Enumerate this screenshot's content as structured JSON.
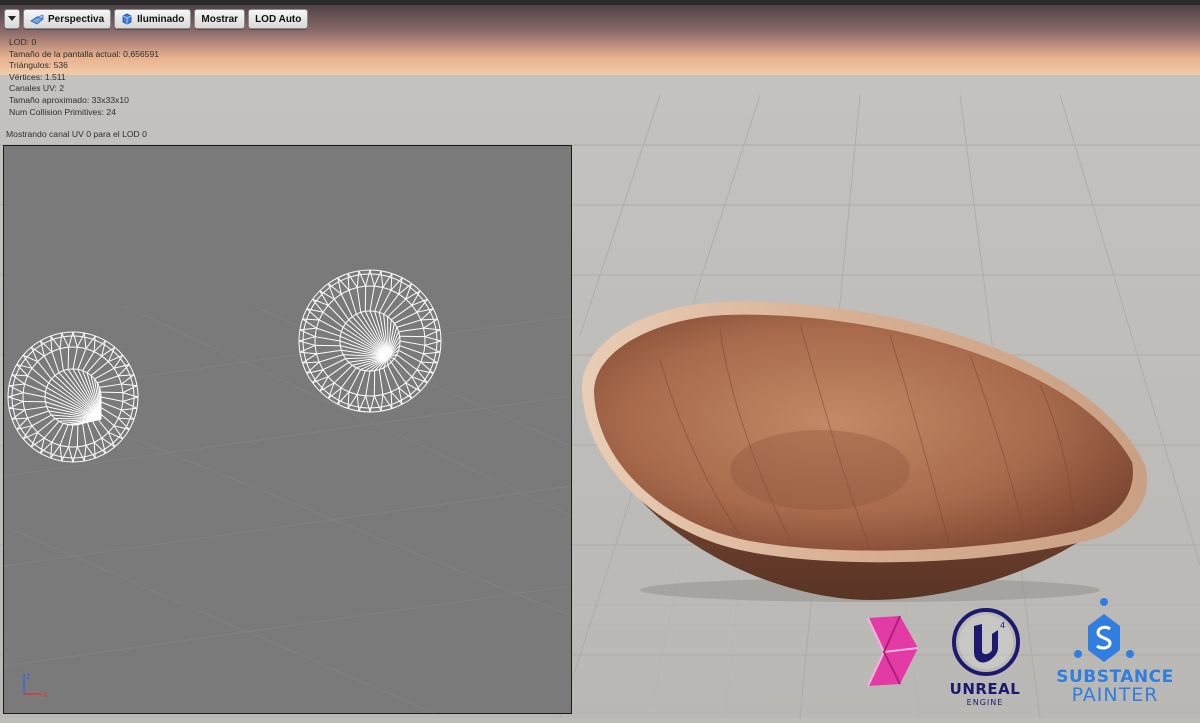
{
  "toolbar": {
    "menu_icon": "chevron-down-icon",
    "perspective_label": "Perspectiva",
    "perspective_icon": "perspective-cube-icon",
    "lit_label": "Iluminado",
    "lit_icon": "lit-sphere-icon",
    "show_label": "Mostrar",
    "lod_label": "LOD Auto"
  },
  "stats": {
    "lod": "LOD:  0",
    "screen_size": "Tamaño de la pantalla actual: 0,656591",
    "triangles": "Triángulos: 536",
    "vertices": "Vértices: 1.511",
    "uv_channels": "Canales UV: 2",
    "approx_size": "Tamaño aproximado: 33x33x10",
    "collision": "Num Collision Primitives:  24"
  },
  "uv_caption": "Mostrando canal UV 0 para el LOD 0",
  "axis_widget": {
    "z": "z",
    "x": "x"
  },
  "logos": {
    "substance_designer_icon": "substance-designer-logo",
    "unreal_line1": "UNREAL",
    "unreal_line2": "ENGINE",
    "substance_line1": "SUBSTANCE",
    "substance_line2": "PAINTER"
  },
  "colors": {
    "sky_top": "#5a4b4e",
    "sky_glow": "#f2c59c",
    "floor": "#bdbcb8",
    "uv_bg": "#7a7a7a",
    "wood": "#a0674a",
    "unreal_blue": "#1c1a6e",
    "substance_blue": "#2f7ee0",
    "designer_pink": "#e43aa6"
  }
}
